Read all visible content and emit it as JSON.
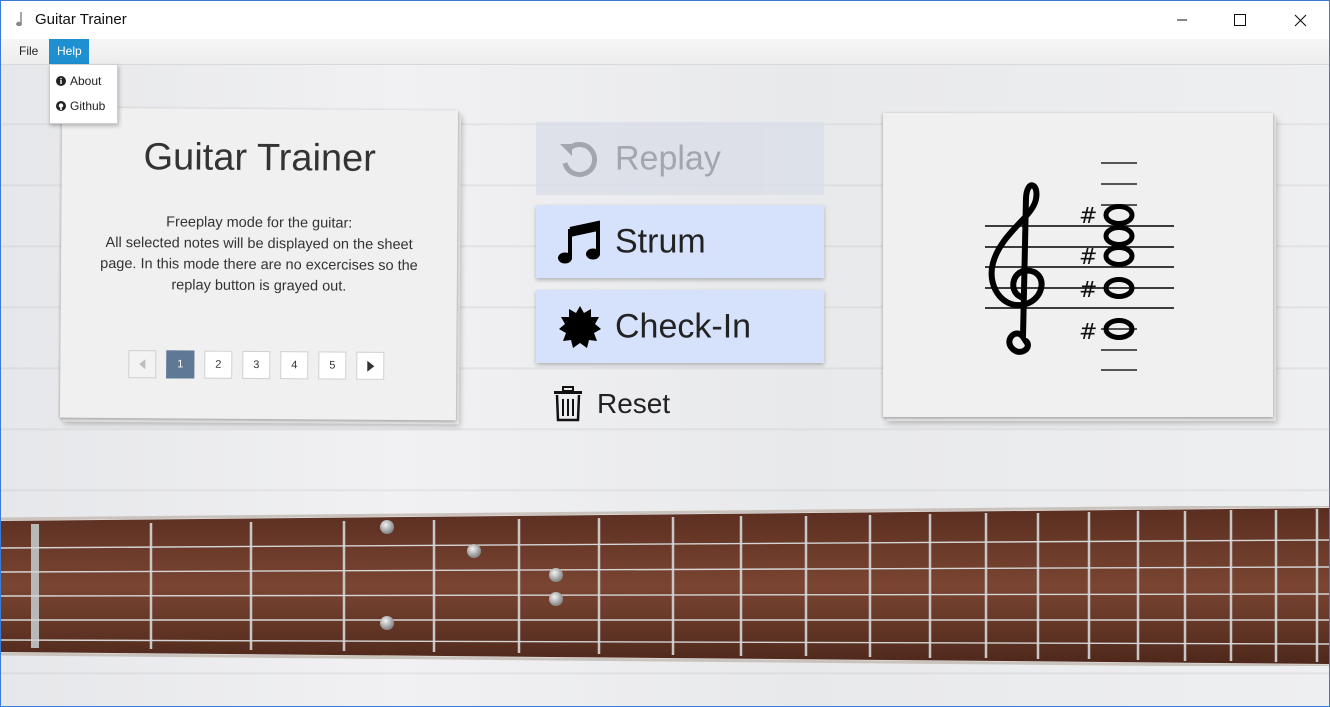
{
  "window": {
    "title": "Guitar Trainer"
  },
  "menu": {
    "items": [
      {
        "label": "File"
      },
      {
        "label": "Help"
      }
    ],
    "help_dropdown": [
      {
        "label": "About",
        "icon": "info-icon"
      },
      {
        "label": "Github",
        "icon": "github-icon"
      }
    ]
  },
  "info_card": {
    "title": "Guitar Trainer",
    "description": "Freeplay mode for the guitar: All selected notes will be displayed on the sheet page. In this mode there are no excercises so the replay button is grayed out.",
    "description_lines": [
      "Freeplay mode for the guitar:",
      "All selected notes will be displayed on the sheet",
      "page. In this mode there are no excercises so the",
      "replay button is grayed out."
    ],
    "pages": [
      "1",
      "2",
      "3",
      "4",
      "5"
    ],
    "active_page": "1"
  },
  "actions": {
    "replay": {
      "label": "Replay",
      "icon": "replay-icon",
      "disabled": true
    },
    "strum": {
      "label": "Strum",
      "icon": "music-note-icon"
    },
    "checkin": {
      "label": "Check-In",
      "icon": "badge-icon"
    },
    "reset": {
      "label": "Reset",
      "icon": "trash-icon"
    }
  },
  "sheet": {
    "clef": "treble",
    "accidentals": [
      "#",
      "#",
      "#",
      "#"
    ]
  },
  "colors": {
    "accent": "#1e8fd0",
    "button_bg": "#d6e2fb",
    "active_page": "#5e7896",
    "fretboard": "#6b3a2a"
  }
}
